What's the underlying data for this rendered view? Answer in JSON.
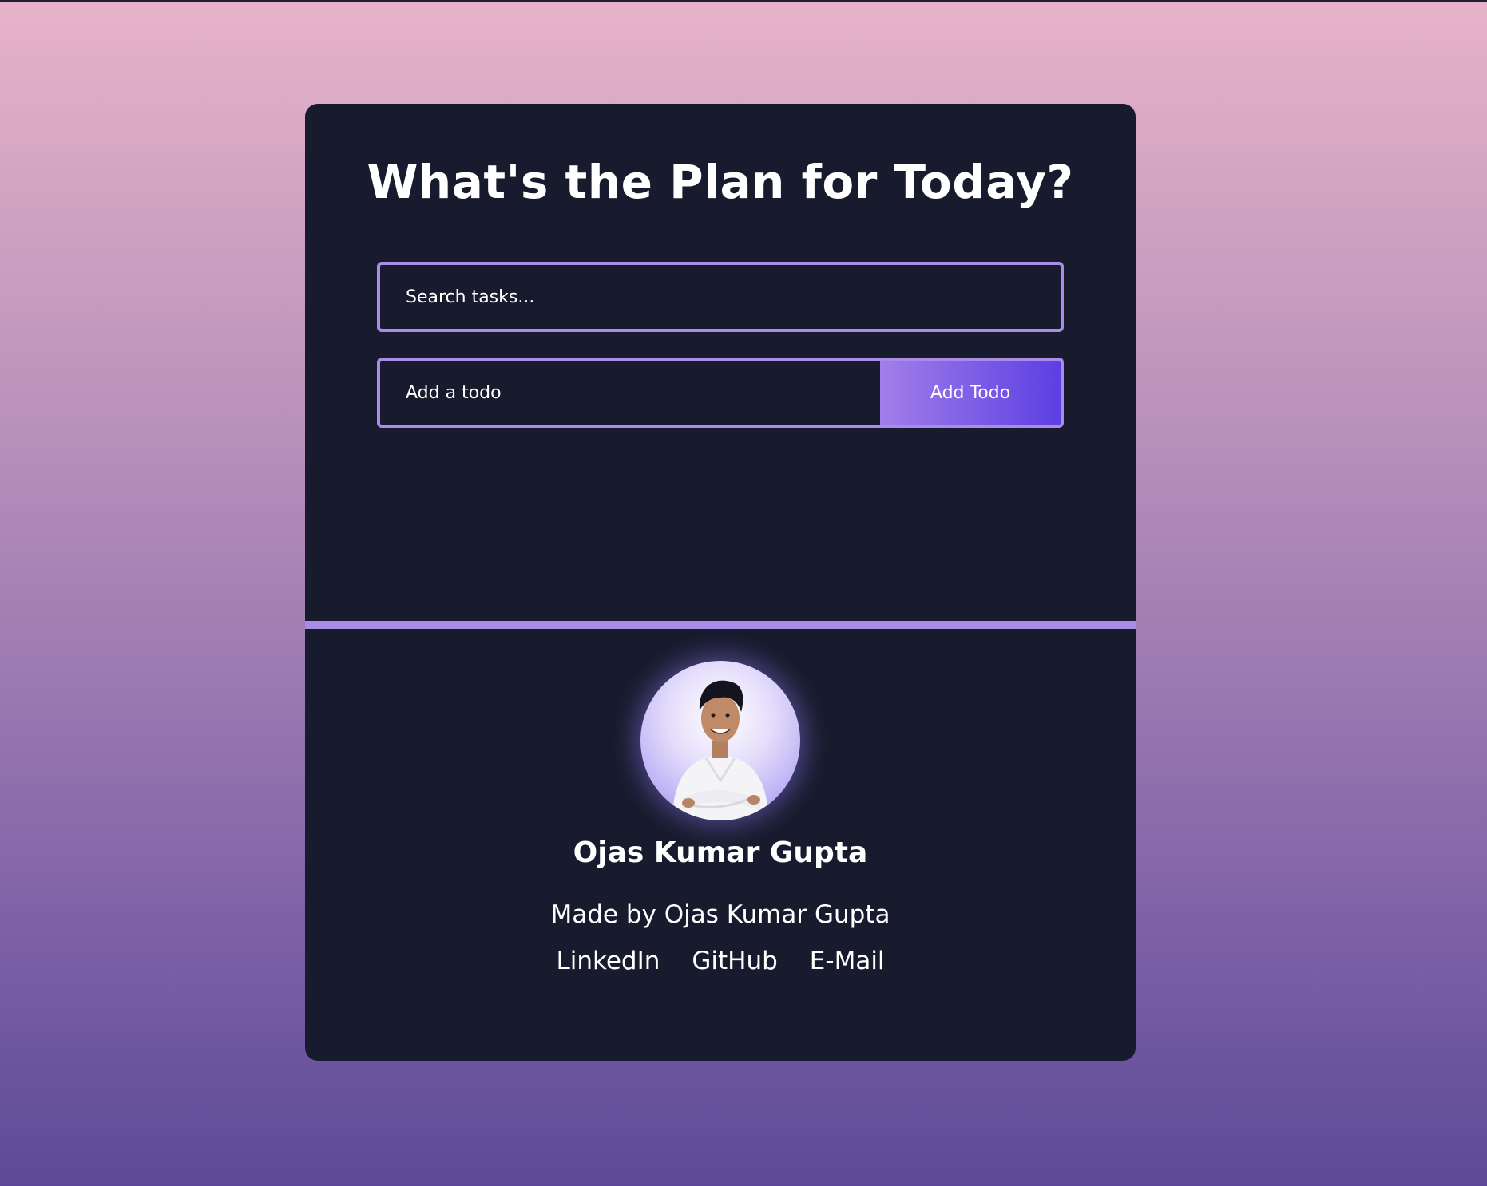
{
  "header": {
    "title": "What's the Plan for Today?"
  },
  "search": {
    "placeholder": "Search tasks..."
  },
  "todo_form": {
    "placeholder": "Add a todo",
    "button_label": "Add Todo"
  },
  "footer": {
    "name": "Ojas Kumar Gupta",
    "made_by": "Made by Ojas Kumar Gupta",
    "links": [
      "LinkedIn",
      "GitHub",
      "E-Mail"
    ]
  },
  "colors": {
    "card_bg": "#181b2d",
    "accent": "#a98be8",
    "button_gradient_start": "#a27fe9",
    "button_gradient_end": "#5b3fe3"
  },
  "icons": {
    "avatar": "profile-photo"
  }
}
